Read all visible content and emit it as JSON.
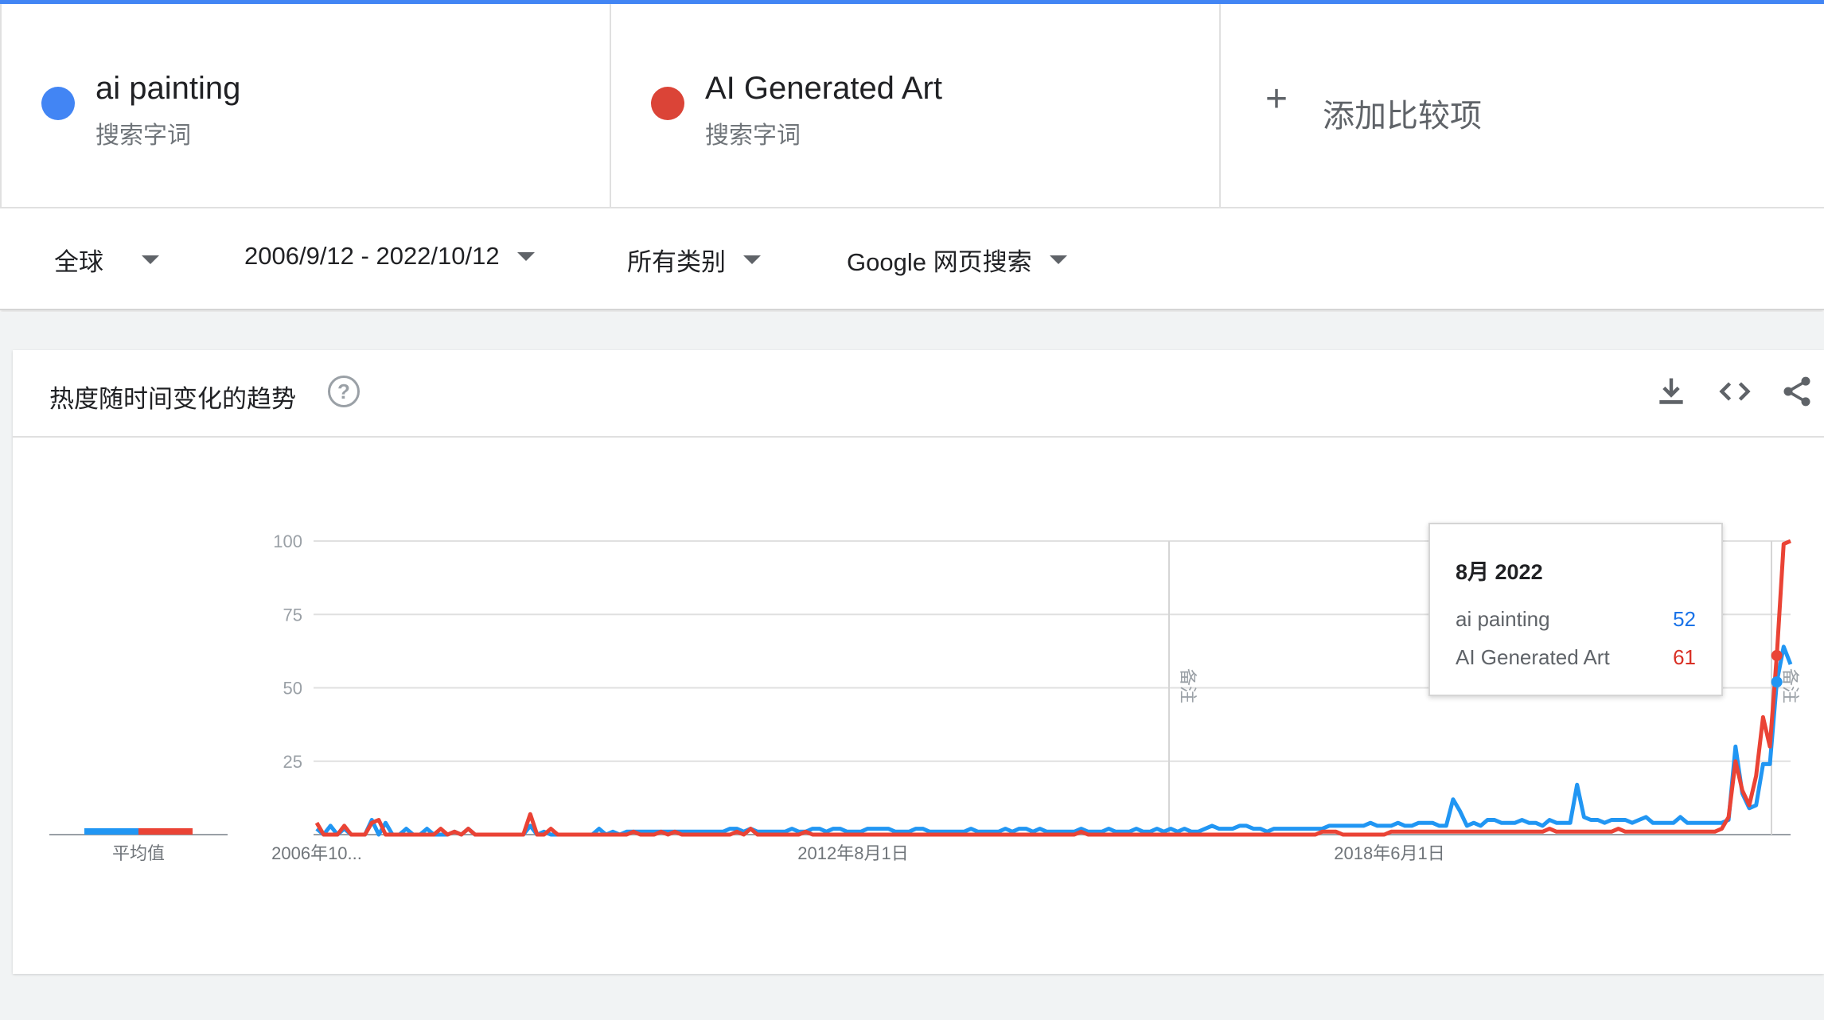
{
  "terms": [
    {
      "name": "ai painting",
      "type": "搜索字词",
      "color": "#4285f4"
    },
    {
      "name": "AI Generated Art",
      "type": "搜索字词",
      "color": "#db4437"
    }
  ],
  "add_compare": {
    "icon": "plus-icon",
    "label": "添加比较项"
  },
  "filters": {
    "region": "全球",
    "date_range": "2006/9/12 - 2022/10/12",
    "category": "所有类别",
    "search_type": "Google 网页搜索"
  },
  "card": {
    "title": "热度随时间变化的趋势",
    "icons": [
      "help-icon",
      "download-icon",
      "embed-code-icon",
      "share-icon"
    ]
  },
  "averages": {
    "label": "平均值",
    "values": [
      2,
      2
    ]
  },
  "notes_label": "备注",
  "tooltip": {
    "title": "8月 2022",
    "rows": [
      {
        "name": "ai painting",
        "value": "52",
        "color": "#1a73e8"
      },
      {
        "name": "AI Generated Art",
        "value": "61",
        "color": "#d93025"
      }
    ]
  },
  "chart_data": {
    "type": "line",
    "y_ticks": [
      "100",
      "75",
      "50",
      "25"
    ],
    "ylim": [
      0,
      100
    ],
    "x_tick_labels": [
      "2006年10...",
      "2012年8月1日",
      "2018年6月1日"
    ],
    "series": [
      {
        "name": "ai painting",
        "color": "#2196f3",
        "values": [
          2,
          0,
          3,
          0,
          2,
          0,
          0,
          0,
          5,
          0,
          4,
          0,
          0,
          2,
          0,
          0,
          2,
          0,
          0,
          0,
          1,
          0,
          2,
          0,
          0,
          0,
          0,
          0,
          0,
          0,
          0,
          3,
          0,
          1,
          0,
          0,
          0,
          0,
          0,
          0,
          0,
          2,
          0,
          1,
          0,
          1,
          1,
          1,
          1,
          1,
          1,
          1,
          1,
          1,
          1,
          1,
          1,
          1,
          1,
          1,
          2,
          2,
          1,
          2,
          1,
          1,
          1,
          1,
          1,
          2,
          1,
          1,
          2,
          2,
          1,
          2,
          2,
          1,
          1,
          1,
          2,
          2,
          2,
          2,
          1,
          1,
          1,
          2,
          2,
          1,
          1,
          1,
          1,
          1,
          1,
          2,
          1,
          1,
          1,
          1,
          2,
          1,
          2,
          2,
          1,
          2,
          1,
          1,
          1,
          1,
          1,
          2,
          1,
          1,
          1,
          2,
          1,
          1,
          1,
          2,
          1,
          1,
          2,
          1,
          2,
          1,
          2,
          1,
          1,
          2,
          3,
          2,
          2,
          2,
          3,
          3,
          2,
          2,
          1,
          2,
          2,
          2,
          2,
          2,
          2,
          2,
          2,
          3,
          3,
          3,
          3,
          3,
          3,
          4,
          3,
          3,
          3,
          4,
          3,
          3,
          4,
          4,
          4,
          3,
          3,
          12,
          8,
          3,
          4,
          3,
          5,
          5,
          4,
          4,
          4,
          5,
          4,
          4,
          3,
          5,
          4,
          4,
          4,
          17,
          6,
          5,
          5,
          4,
          5,
          5,
          5,
          4,
          5,
          6,
          4,
          4,
          4,
          4,
          6,
          4,
          4,
          4,
          4,
          4,
          4,
          5,
          30,
          14,
          9,
          10,
          24,
          24,
          52,
          64,
          58
        ]
      },
      {
        "name": "AI Generated Art",
        "color": "#ea4335",
        "values": [
          4,
          0,
          0,
          0,
          3,
          0,
          0,
          0,
          4,
          5,
          0,
          0,
          0,
          0,
          0,
          0,
          0,
          0,
          2,
          0,
          1,
          0,
          2,
          0,
          0,
          0,
          0,
          0,
          0,
          0,
          0,
          7,
          0,
          0,
          2,
          0,
          0,
          0,
          0,
          0,
          0,
          0,
          0,
          0,
          0,
          0,
          1,
          0,
          0,
          0,
          1,
          0,
          1,
          0,
          0,
          0,
          0,
          0,
          0,
          0,
          0,
          1,
          0,
          2,
          0,
          0,
          0,
          0,
          0,
          0,
          0,
          1,
          0,
          0,
          0,
          0,
          0,
          0,
          0,
          0,
          0,
          0,
          0,
          0,
          0,
          0,
          0,
          0,
          0,
          0,
          0,
          0,
          0,
          0,
          0,
          0,
          0,
          0,
          0,
          0,
          0,
          0,
          0,
          0,
          0,
          0,
          0,
          0,
          0,
          0,
          0,
          1,
          0,
          0,
          0,
          0,
          0,
          0,
          0,
          0,
          0,
          0,
          0,
          0,
          0,
          0,
          0,
          0,
          0,
          0,
          0,
          0,
          0,
          0,
          0,
          0,
          0,
          0,
          0,
          0,
          0,
          0,
          0,
          0,
          0,
          0,
          1,
          1,
          1,
          0,
          0,
          0,
          0,
          0,
          0,
          0,
          1,
          1,
          1,
          1,
          1,
          1,
          1,
          1,
          1,
          1,
          1,
          1,
          1,
          1,
          1,
          1,
          1,
          1,
          1,
          1,
          1,
          1,
          1,
          2,
          1,
          1,
          1,
          1,
          1,
          1,
          1,
          1,
          1,
          2,
          1,
          1,
          1,
          1,
          1,
          1,
          1,
          1,
          1,
          1,
          1,
          1,
          1,
          1,
          2,
          6,
          25,
          15,
          10,
          20,
          40,
          30,
          61,
          99,
          100
        ]
      }
    ]
  }
}
